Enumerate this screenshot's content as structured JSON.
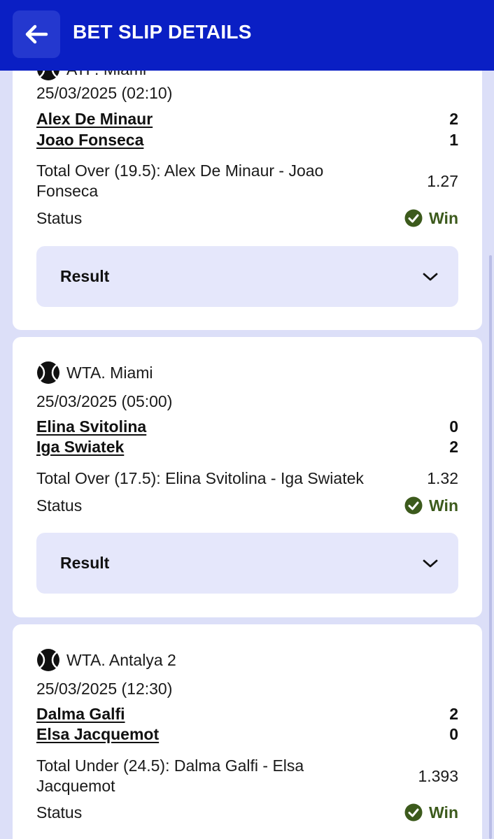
{
  "header": {
    "title": "BET SLIP DETAILS",
    "back_icon": "arrow-left-icon"
  },
  "colors": {
    "header_bg": "#0a1fc4",
    "page_bg": "#dcdff8",
    "win": "#3c5a1c",
    "result_bg": "#e5e7fb"
  },
  "bets": [
    {
      "league": "ATP. Miami",
      "date": "25/03/2025 (02:10)",
      "teams": [
        {
          "name": "Alex De Minaur",
          "score": "2"
        },
        {
          "name": "Joao Fonseca",
          "score": "1"
        }
      ],
      "market": "Total Over (19.5): Alex De Minaur - Joao Fonseca",
      "odds": "1.27",
      "status_label": "Status",
      "status": "Win",
      "result_label": "Result"
    },
    {
      "league": "WTA. Miami",
      "date": "25/03/2025 (05:00)",
      "teams": [
        {
          "name": "Elina Svitolina",
          "score": "0"
        },
        {
          "name": "Iga Swiatek",
          "score": "2"
        }
      ],
      "market": "Total Over (17.5): Elina Svitolina - Iga Swiatek",
      "odds": "1.32",
      "status_label": "Status",
      "status": "Win",
      "result_label": "Result"
    },
    {
      "league": "WTA. Antalya 2",
      "date": "25/03/2025 (12:30)",
      "teams": [
        {
          "name": "Dalma Galfi",
          "score": "2"
        },
        {
          "name": "Elsa Jacquemot",
          "score": "0"
        }
      ],
      "market": "Total Under (24.5): Dalma Galfi - Elsa Jacquemot",
      "odds": "1.393",
      "status_label": "Status",
      "status": "Win"
    }
  ]
}
